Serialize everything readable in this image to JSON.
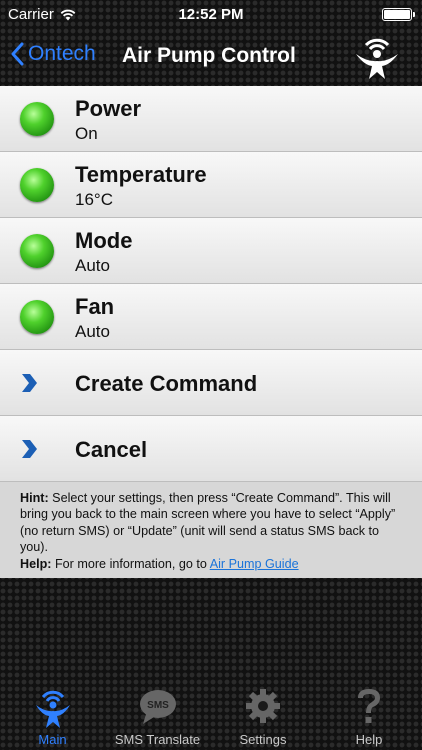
{
  "status": {
    "carrier": "Carrier",
    "time": "12:52 PM"
  },
  "nav": {
    "back_label": "Ontech",
    "title": "Air Pump Control"
  },
  "settings": [
    {
      "label": "Power",
      "value": "On"
    },
    {
      "label": "Temperature",
      "value": "16°C"
    },
    {
      "label": "Mode",
      "value": "Auto"
    },
    {
      "label": "Fan",
      "value": "Auto"
    }
  ],
  "actions": [
    {
      "label": "Create Command"
    },
    {
      "label": "Cancel"
    }
  ],
  "hint": {
    "hint_label": "Hint:",
    "hint_text": " Select your settings, then press “Create Command”. This will bring you back to the main screen where you have to select “Apply” (no return SMS) or “Update” (unit will send a status SMS back to you).",
    "help_label": "Help:",
    "help_text": " For more information, go to ",
    "help_link": "Air Pump Guide"
  },
  "tabs": [
    {
      "label": "Main",
      "icon": "person-wifi-icon",
      "active": true
    },
    {
      "label": "SMS Translate",
      "icon": "sms-bubble-icon",
      "active": false
    },
    {
      "label": "Settings",
      "icon": "gear-icon",
      "active": false
    },
    {
      "label": "Help",
      "icon": "question-icon",
      "active": false
    }
  ],
  "colors": {
    "accent": "#2f80ff",
    "led_green": "#4fd12c",
    "chevron_blue": "#1c5fb5"
  }
}
